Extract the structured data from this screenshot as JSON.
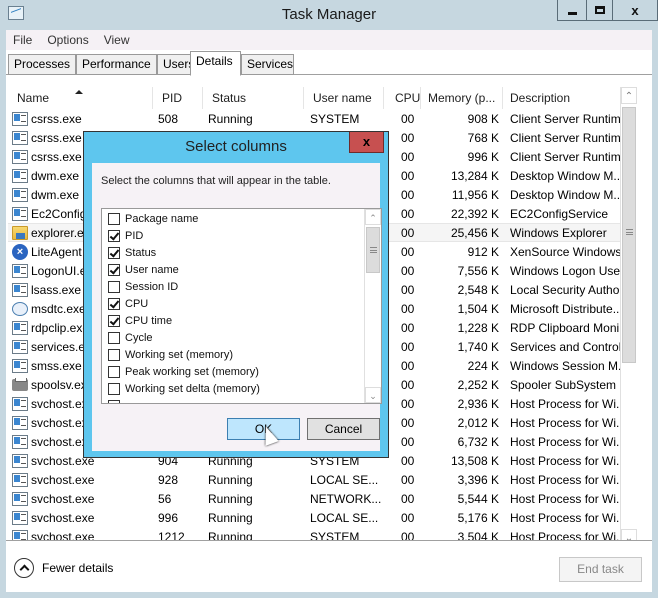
{
  "window": {
    "title": "Task Manager",
    "minimize_icon": "minimize-icon",
    "maximize_icon": "maximize-icon",
    "close_icon": "close-icon",
    "close_glyph": "x"
  },
  "menu": [
    "File",
    "Options",
    "View"
  ],
  "tabs": [
    {
      "label": "Processes",
      "active": false
    },
    {
      "label": "Performance",
      "active": false
    },
    {
      "label": "Users",
      "active": false
    },
    {
      "label": "Details",
      "active": true
    },
    {
      "label": "Services",
      "active": false
    }
  ],
  "table": {
    "columns": [
      "Name",
      "PID",
      "Status",
      "User name",
      "CPU",
      "Memory (p...",
      "Description"
    ],
    "sort_column": "Name",
    "sort_direction": "ascending",
    "rows": [
      {
        "icon": "app",
        "name": "csrss.exe",
        "pid": "508",
        "status": "Running",
        "user": "SYSTEM",
        "cpu": "00",
        "mem": "908 K",
        "desc": "Client Server Runtim..."
      },
      {
        "icon": "app",
        "name": "csrss.exe",
        "pid": "",
        "status": "",
        "user": "",
        "cpu": "00",
        "mem": "768 K",
        "desc": "Client Server Runtim..."
      },
      {
        "icon": "app",
        "name": "csrss.exe",
        "pid": "",
        "status": "",
        "user": "",
        "cpu": "00",
        "mem": "996 K",
        "desc": "Client Server Runtim..."
      },
      {
        "icon": "app",
        "name": "dwm.exe",
        "pid": "",
        "status": "",
        "user": "",
        "cpu": "00",
        "mem": "13,284 K",
        "desc": "Desktop Window M..."
      },
      {
        "icon": "app",
        "name": "dwm.exe",
        "pid": "",
        "status": "",
        "user": "",
        "cpu": "00",
        "mem": "11,956 K",
        "desc": "Desktop Window M..."
      },
      {
        "icon": "app",
        "name": "Ec2Config",
        "pid": "",
        "status": "",
        "user": "",
        "cpu": "00",
        "mem": "22,392 K",
        "desc": "EC2ConfigService"
      },
      {
        "icon": "folder",
        "name": "explorer.exe",
        "pid": "",
        "status": "",
        "user": "",
        "cpu": "00",
        "mem": "25,456 K",
        "desc": "Windows Explorer",
        "highlight": true
      },
      {
        "icon": "xen",
        "name": "LiteAgent",
        "pid": "",
        "status": "",
        "user": "",
        "cpu": "00",
        "mem": "912 K",
        "desc": "XenSource Windows..."
      },
      {
        "icon": "app",
        "name": "LogonUI.exe",
        "pid": "",
        "status": "",
        "user": "",
        "cpu": "00",
        "mem": "7,556 K",
        "desc": "Windows Logon Use..."
      },
      {
        "icon": "app",
        "name": "lsass.exe",
        "pid": "",
        "status": "",
        "user": "",
        "cpu": "00",
        "mem": "2,548 K",
        "desc": "Local Security Autho..."
      },
      {
        "icon": "dtc",
        "name": "msdtc.exe",
        "pid": "",
        "status": "",
        "user": "",
        "cpu": "00",
        "mem": "1,504 K",
        "desc": "Microsoft Distribute..."
      },
      {
        "icon": "app",
        "name": "rdpclip.exe",
        "pid": "",
        "status": "",
        "user": "",
        "cpu": "00",
        "mem": "1,228 K",
        "desc": "RDP Clipboard Moni..."
      },
      {
        "icon": "app",
        "name": "services.exe",
        "pid": "",
        "status": "",
        "user": "",
        "cpu": "00",
        "mem": "1,740 K",
        "desc": "Services and Control..."
      },
      {
        "icon": "app",
        "name": "smss.exe",
        "pid": "",
        "status": "",
        "user": "",
        "cpu": "00",
        "mem": "224 K",
        "desc": "Windows Session M..."
      },
      {
        "icon": "printer",
        "name": "spoolsv.exe",
        "pid": "",
        "status": "",
        "user": "",
        "cpu": "00",
        "mem": "2,252 K",
        "desc": "Spooler SubSystem ..."
      },
      {
        "icon": "app",
        "name": "svchost.exe",
        "pid": "",
        "status": "",
        "user": "",
        "cpu": "00",
        "mem": "2,936 K",
        "desc": "Host Process for Wi..."
      },
      {
        "icon": "app",
        "name": "svchost.exe",
        "pid": "",
        "status": "",
        "user": "",
        "cpu": "00",
        "mem": "2,012 K",
        "desc": "Host Process for Wi..."
      },
      {
        "icon": "app",
        "name": "svchost.exe",
        "pid": "",
        "status": "",
        "user": "",
        "cpu": "00",
        "mem": "6,732 K",
        "desc": "Host Process for Wi..."
      },
      {
        "icon": "app",
        "name": "svchost.exe",
        "pid": "904",
        "status": "Running",
        "user": "SYSTEM",
        "cpu": "00",
        "mem": "13,508 K",
        "desc": "Host Process for Wi..."
      },
      {
        "icon": "app",
        "name": "svchost.exe",
        "pid": "928",
        "status": "Running",
        "user": "LOCAL SE...",
        "cpu": "00",
        "mem": "3,396 K",
        "desc": "Host Process for Wi..."
      },
      {
        "icon": "app",
        "name": "svchost.exe",
        "pid": "56",
        "status": "Running",
        "user": "NETWORK...",
        "cpu": "00",
        "mem": "5,544 K",
        "desc": "Host Process for Wi..."
      },
      {
        "icon": "app",
        "name": "svchost.exe",
        "pid": "996",
        "status": "Running",
        "user": "LOCAL SE...",
        "cpu": "00",
        "mem": "5,176 K",
        "desc": "Host Process for Wi..."
      },
      {
        "icon": "app",
        "name": "svchost.exe",
        "pid": "1212",
        "status": "Running",
        "user": "SYSTEM",
        "cpu": "00",
        "mem": "3,504 K",
        "desc": "Host Process for Wi..."
      }
    ]
  },
  "footer": {
    "fewer_details": "Fewer details",
    "end_task": "End task"
  },
  "dialog": {
    "title": "Select columns",
    "close_glyph": "x",
    "instruction": "Select the columns that will appear in the table.",
    "columns": [
      {
        "label": "Package name",
        "checked": false
      },
      {
        "label": "PID",
        "checked": true
      },
      {
        "label": "Status",
        "checked": true
      },
      {
        "label": "User name",
        "checked": true
      },
      {
        "label": "Session ID",
        "checked": false
      },
      {
        "label": "CPU",
        "checked": true
      },
      {
        "label": "CPU time",
        "checked": true
      },
      {
        "label": "Cycle",
        "checked": false
      },
      {
        "label": "Working set (memory)",
        "checked": false
      },
      {
        "label": "Peak working set (memory)",
        "checked": false
      },
      {
        "label": "Working set delta (memory)",
        "checked": false
      }
    ],
    "ok": "OK",
    "cancel": "Cancel"
  },
  "colors": {
    "dialog_frame": "#5ec6ee",
    "close_red": "#c75050",
    "ok_button": "#bee6fd",
    "window_frame": "#c6d7e0"
  }
}
